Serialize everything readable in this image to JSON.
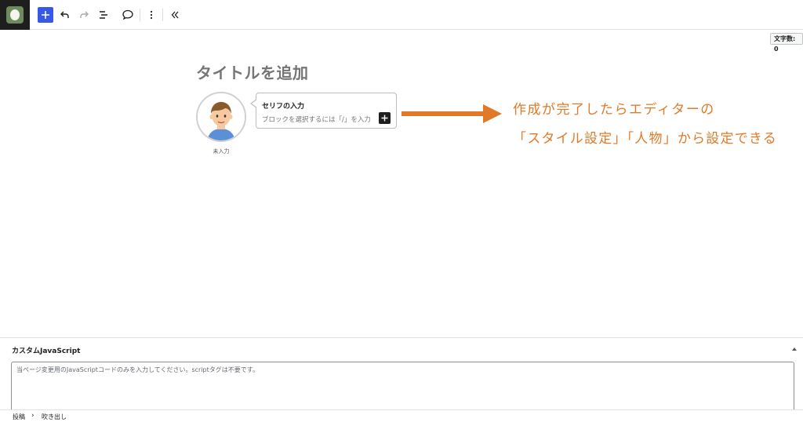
{
  "toolbar": {
    "logo_icon": "site-icon",
    "items": [
      {
        "name": "add-block-button",
        "icon": "plus-icon"
      },
      {
        "name": "undo-button",
        "icon": "undo-icon"
      },
      {
        "name": "redo-button",
        "icon": "redo-icon"
      },
      {
        "name": "document-overview-button",
        "icon": "list-view-icon"
      },
      {
        "name": "comment-button",
        "icon": "speech-bubble-icon"
      },
      {
        "name": "options-button",
        "icon": "more-vertical-icon"
      },
      {
        "name": "collapse-button",
        "icon": "chevrons-left-icon"
      }
    ],
    "accent_color": "#3858e9"
  },
  "word_count": {
    "label": "文字数: 0"
  },
  "editor": {
    "title_placeholder": "タイトルを追加",
    "speech_block": {
      "avatar_label": "未入力",
      "bubble_title": "セリフの入力",
      "bubble_placeholder": "ブロックを選択するには「/」を入力"
    }
  },
  "annotation": {
    "line1": "作成が完了したらエディターの",
    "line2": "「スタイル設定」「人物」から設定できる",
    "color": "#e07a29"
  },
  "metabox": {
    "title": "カスタムJavaScript",
    "textarea_placeholder": "当ページ変更用のJavaScriptコードのみを入力してください。scriptタグは不要です。"
  },
  "breadcrumb": {
    "items": [
      "投稿",
      "吹き出し"
    ],
    "separator": "›"
  }
}
